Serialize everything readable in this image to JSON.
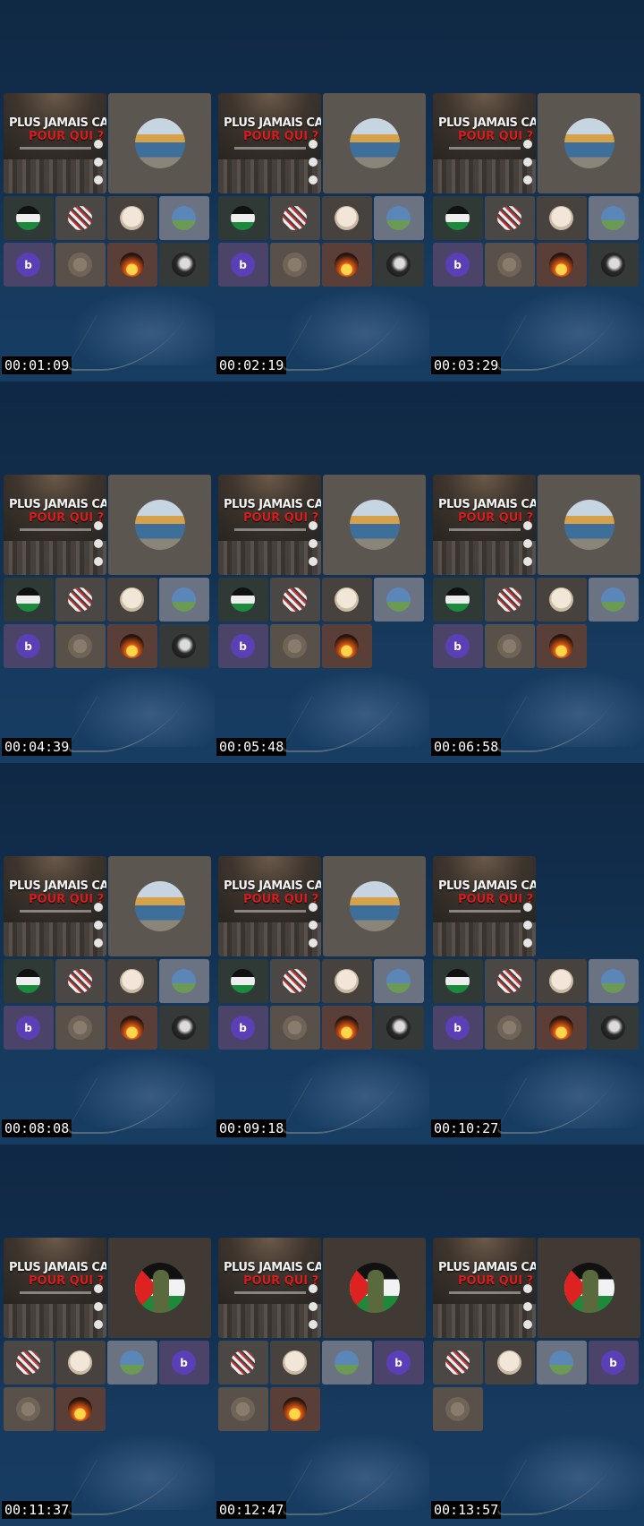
{
  "poster": {
    "title": "PLUS JAMAIS CA...",
    "subtitle": "POUR QUI ?"
  },
  "frames": [
    {
      "time": "00:01:09",
      "feature": "dome",
      "r1": [
        "flag",
        "keffiyeh",
        "face",
        "globe"
      ],
      "r2": [
        "b",
        "cat",
        "sun",
        "hand"
      ]
    },
    {
      "time": "00:02:19",
      "feature": "dome",
      "r1": [
        "flag",
        "keffiyeh",
        "face",
        "globe"
      ],
      "r2": [
        "b",
        "cat",
        "sun",
        "hand"
      ]
    },
    {
      "time": "00:03:29",
      "feature": "dome",
      "r1": [
        "flag",
        "keffiyeh",
        "face",
        "globe"
      ],
      "r2": [
        "b",
        "cat",
        "sun",
        "hand"
      ]
    },
    {
      "time": "00:04:39",
      "feature": "dome",
      "r1": [
        "flag",
        "keffiyeh",
        "face",
        "globe"
      ],
      "r2": [
        "b",
        "cat",
        "sun",
        "hand"
      ]
    },
    {
      "time": "00:05:48",
      "feature": "dome",
      "r1": [
        "flag",
        "keffiyeh",
        "face",
        "globe"
      ],
      "r2": [
        "b",
        "cat",
        "sun"
      ]
    },
    {
      "time": "00:06:58",
      "feature": "dome",
      "r1": [
        "flag",
        "keffiyeh",
        "face",
        "globe"
      ],
      "r2": [
        "b",
        "cat",
        "sun"
      ]
    },
    {
      "time": "00:08:08",
      "feature": "dome",
      "r1": [
        "flag",
        "keffiyeh",
        "face",
        "globe"
      ],
      "r2": [
        "b",
        "cat",
        "sun",
        "hand"
      ]
    },
    {
      "time": "00:09:18",
      "feature": "dome",
      "r1": [
        "flag",
        "keffiyeh",
        "face",
        "globe"
      ],
      "r2": [
        "b",
        "cat",
        "sun",
        "hand"
      ]
    },
    {
      "time": "00:10:27",
      "feature": "none",
      "r1": [
        "flag",
        "keffiyeh",
        "face",
        "globe"
      ],
      "r2": [
        "b",
        "cat",
        "sun",
        "hand"
      ]
    },
    {
      "time": "00:11:37",
      "feature": "flag",
      "r1": [
        "keffiyeh",
        "face",
        "globe",
        "b"
      ],
      "r2": [
        "cat",
        "sun"
      ]
    },
    {
      "time": "00:12:47",
      "feature": "flag",
      "r1": [
        "keffiyeh",
        "face",
        "globe",
        "b"
      ],
      "r2": [
        "cat",
        "sun"
      ]
    },
    {
      "time": "00:13:57",
      "feature": "flag",
      "r1": [
        "keffiyeh",
        "face",
        "globe",
        "b"
      ],
      "r2": [
        "cat"
      ]
    }
  ],
  "tile_letter": "b"
}
